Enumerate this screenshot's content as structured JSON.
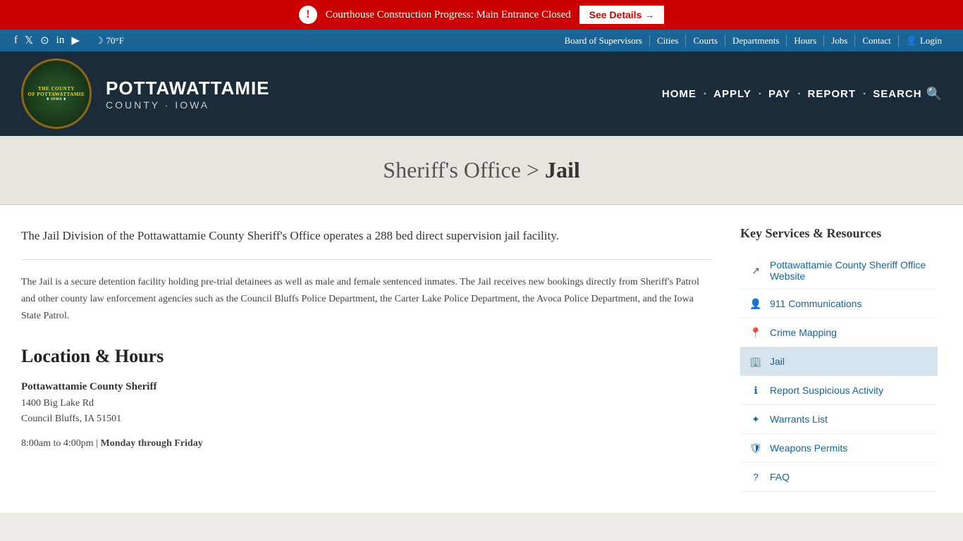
{
  "alert": {
    "icon": "!",
    "message": "Courthouse Construction Progress: Main Entrance Closed",
    "button_label": "See Details →"
  },
  "topbar": {
    "social": [
      {
        "name": "facebook",
        "symbol": "f"
      },
      {
        "name": "twitter",
        "symbol": "𝕏"
      },
      {
        "name": "instagram",
        "symbol": "📷"
      },
      {
        "name": "linkedin",
        "symbol": "in"
      },
      {
        "name": "youtube",
        "symbol": "▶"
      }
    ],
    "weather": "70°F",
    "nav": [
      {
        "label": "Board of Supervisors"
      },
      {
        "label": "Cities"
      },
      {
        "label": "Courts"
      },
      {
        "label": "Departments"
      },
      {
        "label": "Hours"
      },
      {
        "label": "Jobs"
      },
      {
        "label": "Contact"
      }
    ],
    "login_label": "Login"
  },
  "header": {
    "title": "POTTAWATTAMIE",
    "subtitle": "COUNTY · IOWA",
    "logo_alt": "Pottawattamie County Iowa Seal",
    "nav": [
      {
        "label": "HOME"
      },
      {
        "label": "APPLY"
      },
      {
        "label": "PAY"
      },
      {
        "label": "REPORT"
      },
      {
        "label": "SEARCH"
      }
    ]
  },
  "page_title": {
    "parent": "Sheriff's Office",
    "current": "Jail"
  },
  "content": {
    "intro": "The Jail Division of the Pottawattamie County Sheriff's Office operates a 288 bed direct supervision jail facility.",
    "body": "The Jail is a secure detention facility holding pre-trial detainees as well as male and female sentenced inmates. The Jail receives new bookings directly from Sheriff's Patrol and other county law enforcement agencies such as the Council Bluffs Police Department, the Carter Lake Police Department, the Avoca Police Department, and the Iowa State Patrol.",
    "section_heading": "Location & Hours",
    "location_name": "Pottawattamie County Sheriff",
    "address_line1": "1400 Big Lake Rd",
    "address_line2": "Council Bluffs, IA 51501",
    "hours": "8:00am to 4:00pm",
    "hours_days": "Monday through Friday"
  },
  "sidebar": {
    "title": "Key Services & Resources",
    "links": [
      {
        "label": "Pottawattamie County Sheriff Office Website",
        "icon": "external",
        "active": false
      },
      {
        "label": "911 Communications",
        "icon": "person",
        "active": false
      },
      {
        "label": "Crime Mapping",
        "icon": "pin",
        "active": false
      },
      {
        "label": "Jail",
        "icon": "building",
        "active": true
      },
      {
        "label": "Report Suspicious Activity",
        "icon": "info",
        "active": false
      },
      {
        "label": "Warrants List",
        "icon": "star",
        "active": false
      },
      {
        "label": "Weapons Permits",
        "icon": "badge",
        "active": false
      },
      {
        "label": "FAQ",
        "icon": "question",
        "active": false
      }
    ]
  }
}
